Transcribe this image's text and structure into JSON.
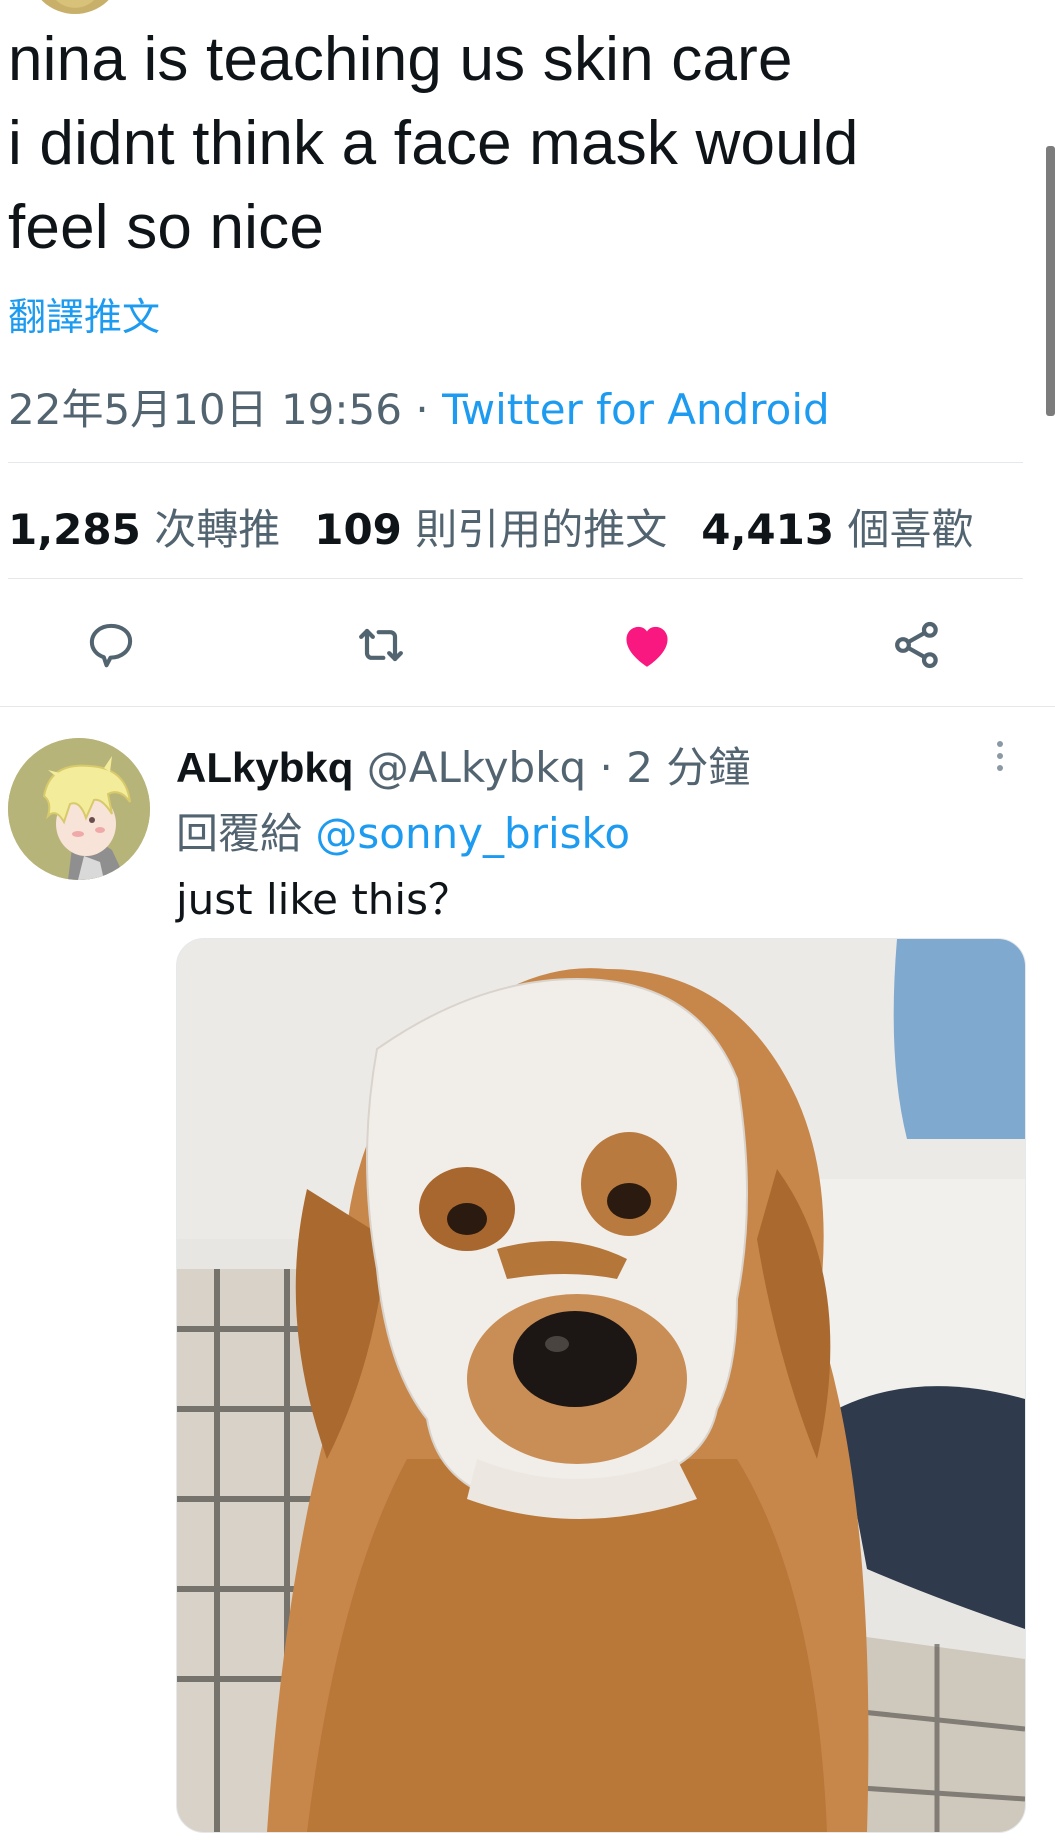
{
  "tweet": {
    "text_lines": [
      "nina is teaching us skin care",
      "i didnt think a face mask would",
      "feel so nice"
    ],
    "translate_label": "翻譯推文",
    "date": "22年5月10日 19:56",
    "separator": " · ",
    "source": "Twitter for Android"
  },
  "stats": {
    "retweets_count": "1,285",
    "retweets_label": " 次轉推",
    "quotes_count": "109",
    "quotes_label": " 則引用的推文",
    "likes_count": "4,413",
    "likes_label": " 個喜歡"
  },
  "actions": [
    {
      "icon": "reply-icon"
    },
    {
      "icon": "retweet-icon"
    },
    {
      "icon": "heart-icon",
      "state": "liked",
      "color": "#f91880"
    },
    {
      "icon": "share-icon"
    }
  ],
  "reply": {
    "display_name": "ALkybkq",
    "handle": "@ALkybkq",
    "separator": " · ",
    "time": "2 分鐘",
    "replying_to_label": "回覆給 ",
    "replying_to_handle": "@sonny_brisko",
    "text": "just like this？",
    "avatar": "anime-character-avatar",
    "media": "golden-retriever-wearing-sheet-face-mask"
  },
  "colors": {
    "accent": "#1d9bf0",
    "like": "#f91880",
    "text_primary": "#0f1419",
    "text_secondary": "#536471"
  }
}
